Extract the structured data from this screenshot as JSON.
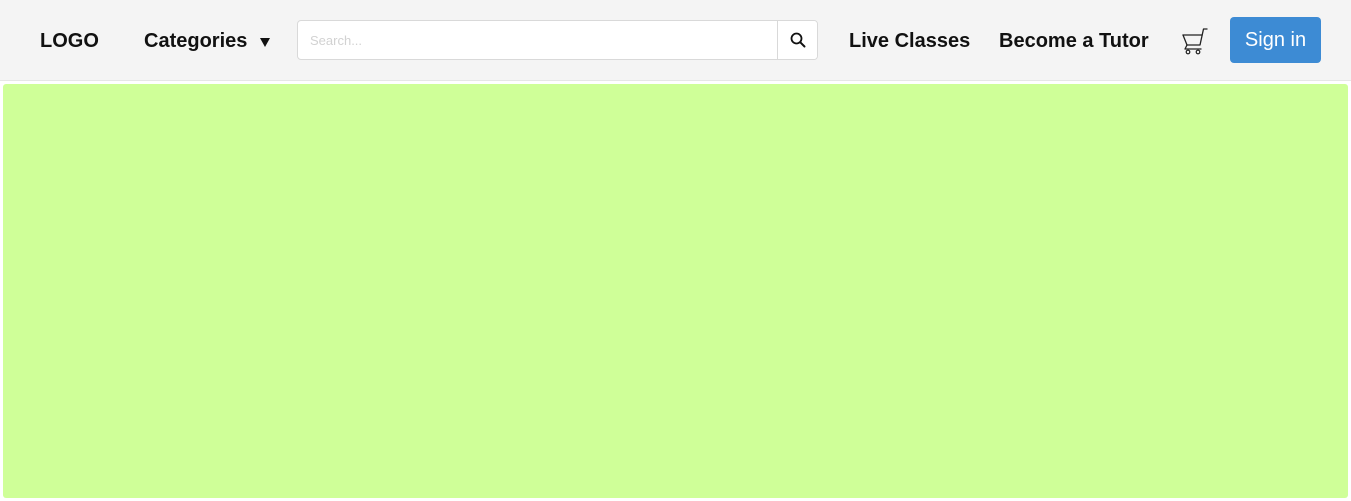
{
  "header": {
    "logo": "LOGO",
    "categories_label": "Categories",
    "search": {
      "placeholder": "Search...",
      "value": "",
      "button_icon": "search-icon"
    },
    "links": [
      "Live Classes",
      "Become a Tutor"
    ],
    "cart_icon": "cart-icon",
    "signin_label": "Sign in",
    "colors": {
      "navbar_bg": "#f4f4f4",
      "signin_bg": "#3d8bd4"
    }
  },
  "hero": {
    "background_color": "#cfff98"
  }
}
